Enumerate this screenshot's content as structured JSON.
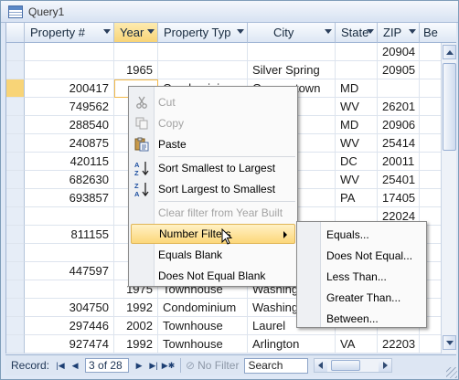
{
  "window": {
    "title": "Query1"
  },
  "columns": [
    {
      "label": "Property #",
      "selected": false
    },
    {
      "label": "Year",
      "selected": true
    },
    {
      "label": "Property Typ",
      "selected": false
    },
    {
      "label": "City",
      "selected": false
    },
    {
      "label": "State",
      "selected": false
    },
    {
      "label": "ZIP",
      "selected": false
    },
    {
      "label": "Be",
      "selected": false
    }
  ],
  "rows": [
    {
      "property": "",
      "year": "",
      "type": "",
      "city": "",
      "state": "",
      "zip": "20904"
    },
    {
      "property": "",
      "year": "1965",
      "type": "",
      "city": "Silver Spring",
      "state": "",
      "zip": "20905"
    },
    {
      "property": "200417",
      "year": "",
      "type": "Condominium",
      "city": "Germantown",
      "state": "MD",
      "zip": ""
    },
    {
      "property": "749562",
      "year": "",
      "type": "",
      "city": "urg",
      "state": "WV",
      "zip": "26201"
    },
    {
      "property": "288540",
      "year": "",
      "type": "",
      "city": "ring",
      "state": "MD",
      "zip": "20906"
    },
    {
      "property": "240875",
      "year": "",
      "type": "",
      "city": "own",
      "state": "WV",
      "zip": "25414"
    },
    {
      "property": "420115",
      "year": "",
      "type": "",
      "city": "",
      "state": "DC",
      "zip": "20011"
    },
    {
      "property": "682630",
      "year": "",
      "type": "",
      "city": "ourg",
      "state": "WV",
      "zip": "25401"
    },
    {
      "property": "693857",
      "year": "",
      "type": "",
      "city": "",
      "state": "PA",
      "zip": "17405"
    },
    {
      "property": "",
      "year": "",
      "type": "",
      "city": "ria",
      "state": "",
      "zip": "22024"
    },
    {
      "property": "811155",
      "year": "",
      "type": "",
      "city": "",
      "state": "",
      "zip": ""
    },
    {
      "property": "",
      "year": "",
      "type": "",
      "city": "",
      "state": "",
      "zip": ""
    },
    {
      "property": "447597",
      "year": "",
      "type": "",
      "city": "",
      "state": "",
      "zip": ""
    },
    {
      "property": "",
      "year": "1975",
      "type": "Townhouse",
      "city": "Washing",
      "state": "",
      "zip": ""
    },
    {
      "property": "304750",
      "year": "1992",
      "type": "Condominium",
      "city": "Washing",
      "state": "",
      "zip": ""
    },
    {
      "property": "297446",
      "year": "2002",
      "type": "Townhouse",
      "city": "Laurel",
      "state": "",
      "zip": ""
    },
    {
      "property": "927474",
      "year": "1992",
      "type": "Townhouse",
      "city": "Arlington",
      "state": "VA",
      "zip": "22203"
    }
  ],
  "context_menu": {
    "items": [
      {
        "label": "Cut",
        "icon": "scissors-icon",
        "disabled": true
      },
      {
        "label": "Copy",
        "icon": "copy-icon",
        "disabled": true
      },
      {
        "label": "Paste",
        "icon": "paste-icon",
        "disabled": false
      },
      {
        "label": "Sort Smallest to Largest",
        "icon": "sort-ascending-icon",
        "disabled": false
      },
      {
        "label": "Sort Largest to Smallest",
        "icon": "sort-descending-icon",
        "disabled": false
      },
      {
        "label": "Clear filter from Year Built",
        "icon": "clear-filter-icon",
        "disabled": true
      },
      {
        "label": "Number Filters",
        "icon": "",
        "disabled": false
      },
      {
        "label": "Equals Blank",
        "icon": "",
        "disabled": false
      },
      {
        "label": "Does Not Equal Blank",
        "icon": "",
        "disabled": false
      }
    ]
  },
  "submenu": {
    "items": [
      "Equals...",
      "Does Not Equal...",
      "Less Than...",
      "Greater Than...",
      "Between..."
    ]
  },
  "navbar": {
    "record_label": "Record:",
    "position": "3 of 28",
    "no_filter": "No Filter",
    "search": "Search"
  },
  "colors": {
    "accent_header": "#f8d477",
    "grid_border": "#dde4ee",
    "menu_hover": "#fcd77a"
  }
}
